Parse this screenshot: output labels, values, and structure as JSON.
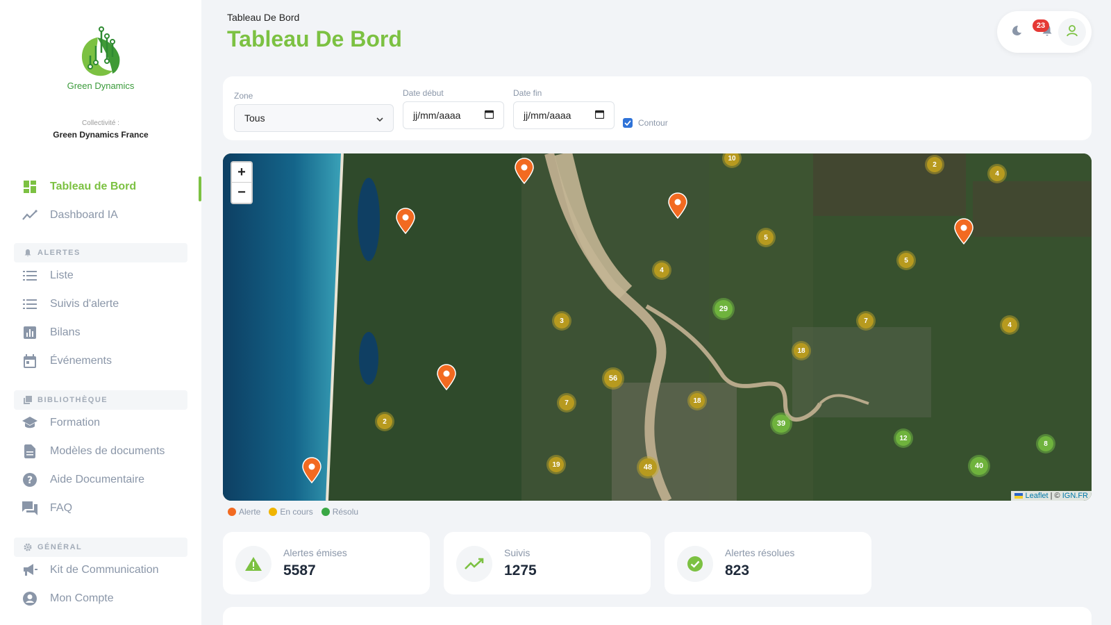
{
  "brand": {
    "name": "Green Dynamics"
  },
  "collectivity": {
    "label": "Collectivité :",
    "value": "Green Dynamics France"
  },
  "sidebar": {
    "main": [
      {
        "label": "Tableau de Bord",
        "icon": "dashboard-icon"
      },
      {
        "label": "Dashboard IA",
        "icon": "trend-icon"
      }
    ],
    "alertes_title": "ALERTES",
    "alertes": [
      {
        "label": "Liste",
        "icon": "list-icon"
      },
      {
        "label": "Suivis d'alerte",
        "icon": "list-icon"
      },
      {
        "label": "Bilans",
        "icon": "bar-chart-icon"
      },
      {
        "label": "Événements",
        "icon": "calendar-icon"
      }
    ],
    "bibliotheque_title": "BIBLIOTHÈQUE",
    "bibliotheque": [
      {
        "label": "Formation",
        "icon": "school-icon"
      },
      {
        "label": "Modèles de documents",
        "icon": "document-icon"
      },
      {
        "label": "Aide Documentaire",
        "icon": "help-icon"
      },
      {
        "label": "FAQ",
        "icon": "chat-icon"
      }
    ],
    "general_title": "GÉNÉRAL",
    "general": [
      {
        "label": "Kit de Communication",
        "icon": "megaphone-icon"
      },
      {
        "label": "Mon Compte",
        "icon": "account-icon"
      }
    ]
  },
  "header": {
    "breadcrumb": "Tableau De Bord",
    "title": "Tableau De Bord",
    "notification_count": "23"
  },
  "filters": {
    "zone_label": "Zone",
    "zone_value": "Tous",
    "date_debut_label": "Date début",
    "date_debut_placeholder": "jj/mm/aaaa",
    "date_fin_label": "Date fin",
    "date_fin_placeholder": "jj/mm/aaaa",
    "contour_label": "Contour",
    "contour_checked": true
  },
  "map": {
    "attribution_leaflet": "Leaflet",
    "attribution_sep": " | © ",
    "attribution_ign": "IGN.FR",
    "zoom_in": "+",
    "zoom_out": "−",
    "clusters": [
      {
        "count": "10",
        "status": "en-cours"
      },
      {
        "count": "2",
        "status": "en-cours"
      },
      {
        "count": "4",
        "status": "en-cours"
      },
      {
        "count": "5",
        "status": "en-cours"
      },
      {
        "count": "4",
        "status": "en-cours"
      },
      {
        "count": "5",
        "status": "en-cours"
      },
      {
        "count": "29",
        "status": "resolu"
      },
      {
        "count": "3",
        "status": "en-cours"
      },
      {
        "count": "7",
        "status": "en-cours"
      },
      {
        "count": "4",
        "status": "en-cours"
      },
      {
        "count": "18",
        "status": "en-cours"
      },
      {
        "count": "56",
        "status": "en-cours"
      },
      {
        "count": "18",
        "status": "en-cours"
      },
      {
        "count": "7",
        "status": "en-cours"
      },
      {
        "count": "39",
        "status": "resolu"
      },
      {
        "count": "2",
        "status": "en-cours"
      },
      {
        "count": "12",
        "status": "resolu"
      },
      {
        "count": "8",
        "status": "resolu"
      },
      {
        "count": "19",
        "status": "en-cours"
      },
      {
        "count": "48",
        "status": "en-cours"
      },
      {
        "count": "40",
        "status": "resolu"
      }
    ]
  },
  "legend": [
    {
      "label": "Alerte",
      "color": "#f26a21"
    },
    {
      "label": "En cours",
      "color": "#f0b400"
    },
    {
      "label": "Résolu",
      "color": "#3aa845"
    }
  ],
  "stats": [
    {
      "label": "Alertes émises",
      "value": "5587",
      "icon": "warning-icon"
    },
    {
      "label": "Suivis",
      "value": "1275",
      "icon": "trend-icon"
    },
    {
      "label": "Alertes résolues",
      "value": "823",
      "icon": "check-circle-icon"
    }
  ],
  "colors": {
    "accent": "#7cc142",
    "alert": "#f26a21",
    "badge": "#e53935"
  }
}
